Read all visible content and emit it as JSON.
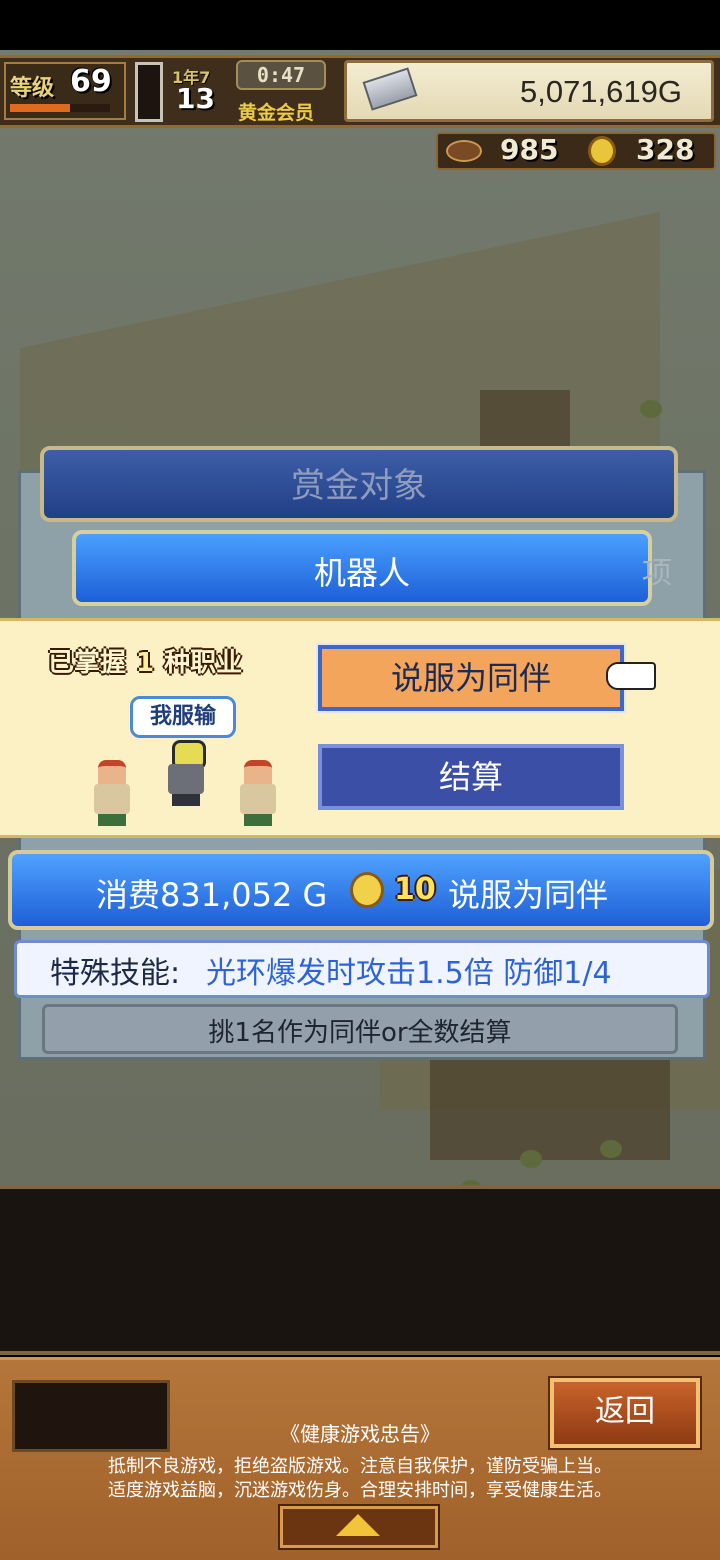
{
  "hud": {
    "level_label": "等级",
    "level": "69",
    "level_progress": 0.6,
    "battery_level": 0.3,
    "year_label": "1年7",
    "year": "13",
    "clock": "0:47",
    "membership": "黄金会员",
    "gold": "5,071,619G",
    "resource1": "985",
    "resource2": "328"
  },
  "dialog": {
    "title": "赏金对象",
    "target": "机器人",
    "side_text": "项",
    "mastered_prefix": "已掌握",
    "mastered_count": "1",
    "mastered_suffix": "种职业",
    "speech": "我服输",
    "persuade_label": "说服为同伴",
    "settle_label": "结算",
    "cost_text": "消费831,052 G",
    "coin_count": "10",
    "cost_suffix": "说服为同伴",
    "skill_label": "特殊技能:",
    "skill_value": "光环爆发时攻击1.5倍 防御1/4",
    "hint": "挑1名作为同伴or全数结算"
  },
  "footer": {
    "back_label": "返回",
    "notice_title": "《健康游戏忠告》",
    "notice_line1": "抵制不良游戏，拒绝盗版游戏。注意自我保护，谨防受骗上当。",
    "notice_line2": "适度游戏益脑，沉迷游戏伤身。合理安排时间，享受健康生活。"
  },
  "icons": {
    "gold": "silver-bar-icon",
    "resource1": "football-icon",
    "resource2": "medal-coin-icon",
    "hand": "pointing-hand-icon",
    "up": "up-arrow-icon"
  },
  "colors": {
    "hud_bg": "#3f2e1c",
    "dialog_blue": "#1d5fd8",
    "panel_cream": "#fbf1c4",
    "persuade_orange": "#f3a55b",
    "settle_blue": "#3c4fa6",
    "skill_blue": "#2e63d6",
    "back_orange": "#c9632a"
  }
}
